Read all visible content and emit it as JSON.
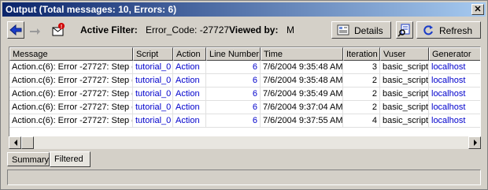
{
  "window": {
    "title": "Output (Total messages: 10, Errors: 6)",
    "close_glyph": "✕"
  },
  "toolbar": {
    "active_filter_label": "Active Filter:",
    "active_filter_value": "Error_Code: -27727",
    "viewed_by_label": "Viewed by:",
    "viewed_by_value": "M",
    "details_label": "Details",
    "refresh_label": "Refresh",
    "icons": [
      "back-arrow-icon",
      "forward-arrow-icon",
      "error-envelope-icon",
      "details-icon",
      "log-search-icon",
      "refresh-icon"
    ]
  },
  "table": {
    "columns": [
      "Message",
      "Script",
      "Action",
      "Line Number",
      "Time",
      "Iteration",
      "Vuser",
      "Generator"
    ],
    "rows": [
      [
        "Action.c(6): Error -27727: Step d",
        "tutorial_0",
        "Action",
        "6",
        "7/6/2004 9:35:48 AM",
        "3",
        "basic_script",
        "localhost"
      ],
      [
        "Action.c(6): Error -27727: Step d",
        "tutorial_0",
        "Action",
        "6",
        "7/6/2004 9:35:48 AM",
        "2",
        "basic_script",
        "localhost"
      ],
      [
        "Action.c(6): Error -27727: Step d",
        "tutorial_0",
        "Action",
        "6",
        "7/6/2004 9:35:49 AM",
        "2",
        "basic_script",
        "localhost"
      ],
      [
        "Action.c(6): Error -27727: Step d",
        "tutorial_0",
        "Action",
        "6",
        "7/6/2004 9:37:04 AM",
        "2",
        "basic_script",
        "localhost"
      ],
      [
        "Action.c(6): Error -27727: Step d",
        "tutorial_0",
        "Action",
        "6",
        "7/6/2004 9:37:55 AM",
        "4",
        "basic_script",
        "localhost"
      ]
    ]
  },
  "tabs": [
    "Summary",
    "Filtered"
  ],
  "active_tab": "Filtered",
  "colors": {
    "title_start": "#0a246a",
    "title_end": "#a6caf0",
    "link": "#0000cc",
    "face": "#d4d0c8"
  }
}
